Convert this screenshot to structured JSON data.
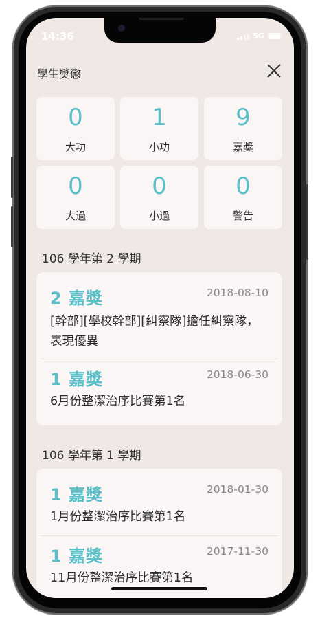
{
  "status": {
    "time": "14:36",
    "network": "5G"
  },
  "header": {
    "title": "學生獎懲"
  },
  "stats": [
    {
      "value": "0",
      "label": "大功"
    },
    {
      "value": "1",
      "label": "小功"
    },
    {
      "value": "9",
      "label": "嘉獎"
    },
    {
      "value": "0",
      "label": "大過"
    },
    {
      "value": "0",
      "label": "小過"
    },
    {
      "value": "0",
      "label": "警告"
    }
  ],
  "semesters": [
    {
      "title": "106 學年第 2 學期",
      "records": [
        {
          "title": "2 嘉獎",
          "date": "2018-08-10",
          "desc": "[幹部][學校幹部][糾察隊]擔任糾察隊，表現優異"
        },
        {
          "title": "1 嘉獎",
          "date": "2018-06-30",
          "desc": "6月份整潔治序比賽第1名"
        }
      ]
    },
    {
      "title": "106 學年第 1 學期",
      "records": [
        {
          "title": "1 嘉獎",
          "date": "2018-01-30",
          "desc": "1月份整潔治序比賽第1名"
        },
        {
          "title": "1 嘉獎",
          "date": "2017-11-30",
          "desc": "11月份整潔治序比賽第1名"
        }
      ]
    }
  ]
}
